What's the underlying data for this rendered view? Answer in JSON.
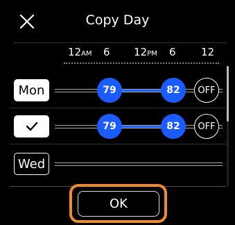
{
  "header": {
    "title": "Copy Day",
    "close_icon": "close-icon"
  },
  "ruler": {
    "labels": [
      {
        "main": "12",
        "suffix": "AM"
      },
      {
        "main": "6",
        "suffix": ""
      },
      {
        "main": "12",
        "suffix": "PM"
      },
      {
        "main": "6",
        "suffix": ""
      },
      {
        "main": "12",
        "suffix": ""
      }
    ]
  },
  "rows": [
    {
      "day_label": "Mon",
      "state": "selected",
      "start_temp": "79",
      "end_temp": "82",
      "off_label": "OFF"
    },
    {
      "day_label": "",
      "state": "checked",
      "check_icon": "checkmark-icon",
      "start_temp": "79",
      "end_temp": "82",
      "off_label": "OFF"
    },
    {
      "day_label": "Wed",
      "state": "unselected"
    }
  ],
  "footer": {
    "ok_label": "OK"
  },
  "colors": {
    "accent_blue": "#1a5cff",
    "focus_ring_orange": "#f08a2c",
    "background": "#000000"
  }
}
